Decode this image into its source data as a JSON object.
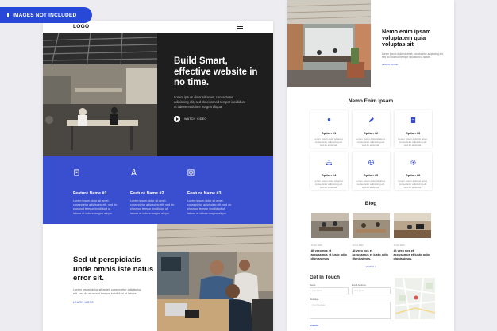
{
  "badge": {
    "label": "IMAGES NOT INCLUDED"
  },
  "left": {
    "logo": "LOGO",
    "hero": {
      "title": "Build Smart, effective website in no time.",
      "text": "Lorem ipsum dolor sit amet, consectetur adipiscing elit, sed do eiusmod tempor incididunt ut labore et dolore magna aliqua.",
      "watch": "WATCH VIDEO"
    },
    "features": [
      {
        "title": "Feature Name #1",
        "text": "Lorem ipsum dolor sit amet, consectetur adipiscing elit, sed do eiusmod tempor incididunt ut labore et dolore magna aliqua.",
        "icon": "building-icon"
      },
      {
        "title": "Feature Name #2",
        "text": "Lorem ipsum dolor sit amet, consectetur adipiscing elit, sed do eiusmod tempor incididunt ut labore et dolore magna aliqua.",
        "icon": "compass-icon"
      },
      {
        "title": "Feature Name #3",
        "text": "Lorem ipsum dolor sit amet, consectetur adipiscing elit, sed do eiusmod tempor incididunt ut labore et dolore magna aliqua.",
        "icon": "target-icon"
      }
    ],
    "bottom": {
      "title": "Sed ut perspiciatis unde omnis iste natus error sit.",
      "text": "Lorem ipsum dolor sit amet, consectetur adipiscing elit, sed do eiusmod tempor incididunt ut labore.",
      "more": "LEARN MORE"
    }
  },
  "right": {
    "top": {
      "title": "Nemo enim ipsam voluptatem quia voluptas sit",
      "text": "Lorem ipsum dolor sit amet, consectetur adipiscing elit, sed do eiusmod tempor incididunt ut labore.",
      "more": "LEARN MORE"
    },
    "options_title": "Nemo Enim Ipsam",
    "options": [
      {
        "title": "Option #1",
        "text": "Lorem ipsum dolor sit amet, consectetur adipiscing elit sed do eiusmod."
      },
      {
        "title": "Option #2",
        "text": "Lorem ipsum dolor sit amet, consectetur adipiscing elit sed do eiusmod."
      },
      {
        "title": "Option #3",
        "text": "Lorem ipsum dolor sit amet, consectetur adipiscing elit sed do eiusmod."
      },
      {
        "title": "Option #4",
        "text": "Lorem ipsum dolor sit amet, consectetur adipiscing elit sed do eiusmod."
      },
      {
        "title": "Option #5",
        "text": "Lorem ipsum dolor sit amet, consectetur adipiscing elit sed do eiusmod."
      },
      {
        "title": "Option #6",
        "text": "Lorem ipsum dolor sit amet, consectetur adipiscing elit sed do eiusmod."
      }
    ],
    "blog_title": "Blog",
    "posts": [
      {
        "meta": "10 Oct 2020",
        "title": "At vero eos et accusamus et iusto odio dignissimos."
      },
      {
        "meta": "10 Oct 2020",
        "title": "At vero eos et accusamus et iusto odio dignissimos."
      },
      {
        "meta": "10 Oct 2020",
        "title": "At vero eos et accusamus et iusto odio dignissimos."
      }
    ],
    "view_all": "VIEW ALL",
    "contact": {
      "title": "Get In Touch",
      "name_label": "Name",
      "email_label": "Email Address",
      "message_label": "Message",
      "name_placeholder": "Your Name",
      "email_placeholder": "Your Email",
      "message_placeholder": "Your Message",
      "submit": "SUBMIT"
    }
  },
  "colors": {
    "accent": "#3a4fd0",
    "dark": "#1e1e1f",
    "badge": "#2848d8"
  }
}
